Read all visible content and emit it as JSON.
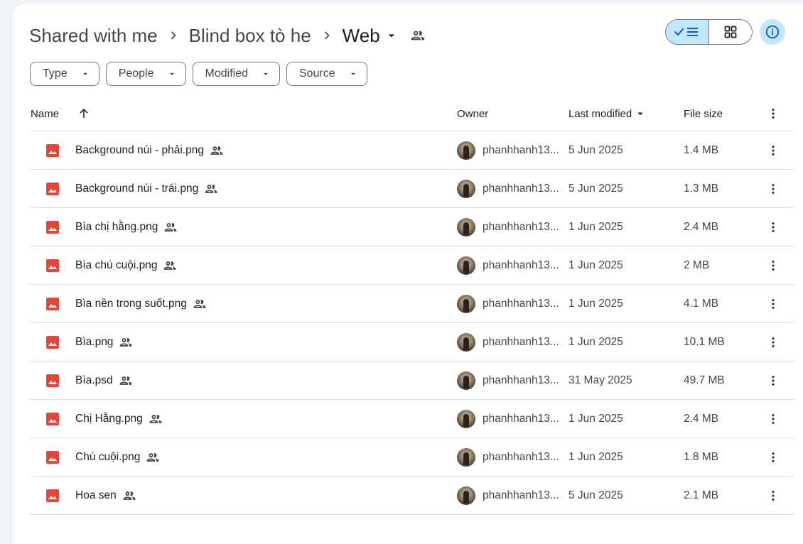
{
  "breadcrumb": {
    "items": [
      "Shared with me",
      "Blind box tò he"
    ],
    "current": "Web"
  },
  "filters": [
    "Type",
    "People",
    "Modified",
    "Source"
  ],
  "columns": {
    "name": "Name",
    "owner": "Owner",
    "modified": "Last modified",
    "size": "File size"
  },
  "files": [
    {
      "name": "Background núi - phải.png",
      "owner": "phanhhanh13...",
      "modified": "5 Jun 2025",
      "size": "1.4 MB"
    },
    {
      "name": "Background núi - trái.png",
      "owner": "phanhhanh13...",
      "modified": "5 Jun 2025",
      "size": "1.3 MB"
    },
    {
      "name": "Bìa chị hằng.png",
      "owner": "phanhhanh13...",
      "modified": "1 Jun 2025",
      "size": "2.4 MB"
    },
    {
      "name": "Bìa chú cuội.png",
      "owner": "phanhhanh13...",
      "modified": "1 Jun 2025",
      "size": "2 MB"
    },
    {
      "name": "Bìa nền trong suốt.png",
      "owner": "phanhhanh13...",
      "modified": "1 Jun 2025",
      "size": "4.1 MB"
    },
    {
      "name": "Bìa.png",
      "owner": "phanhhanh13...",
      "modified": "1 Jun 2025",
      "size": "10.1 MB"
    },
    {
      "name": "Bìa.psd",
      "owner": "phanhhanh13...",
      "modified": "31 May 2025",
      "size": "49.7 MB"
    },
    {
      "name": "Chị Hằng.png",
      "owner": "phanhhanh13...",
      "modified": "1 Jun 2025",
      "size": "2.4 MB"
    },
    {
      "name": "Chú cuội.png",
      "owner": "phanhhanh13...",
      "modified": "1 Jun 2025",
      "size": "1.8 MB"
    },
    {
      "name": "Hoa sen",
      "owner": "phanhhanh13...",
      "modified": "5 Jun 2025",
      "size": "2.1 MB"
    }
  ],
  "icons": {
    "file_type": "image-file-icon",
    "shared": "people-icon",
    "row_menu": "more-vert-icon"
  },
  "colors": {
    "accent": "#c2e7ff",
    "image_icon": "#ea4335",
    "background": "#f0f4f9"
  }
}
